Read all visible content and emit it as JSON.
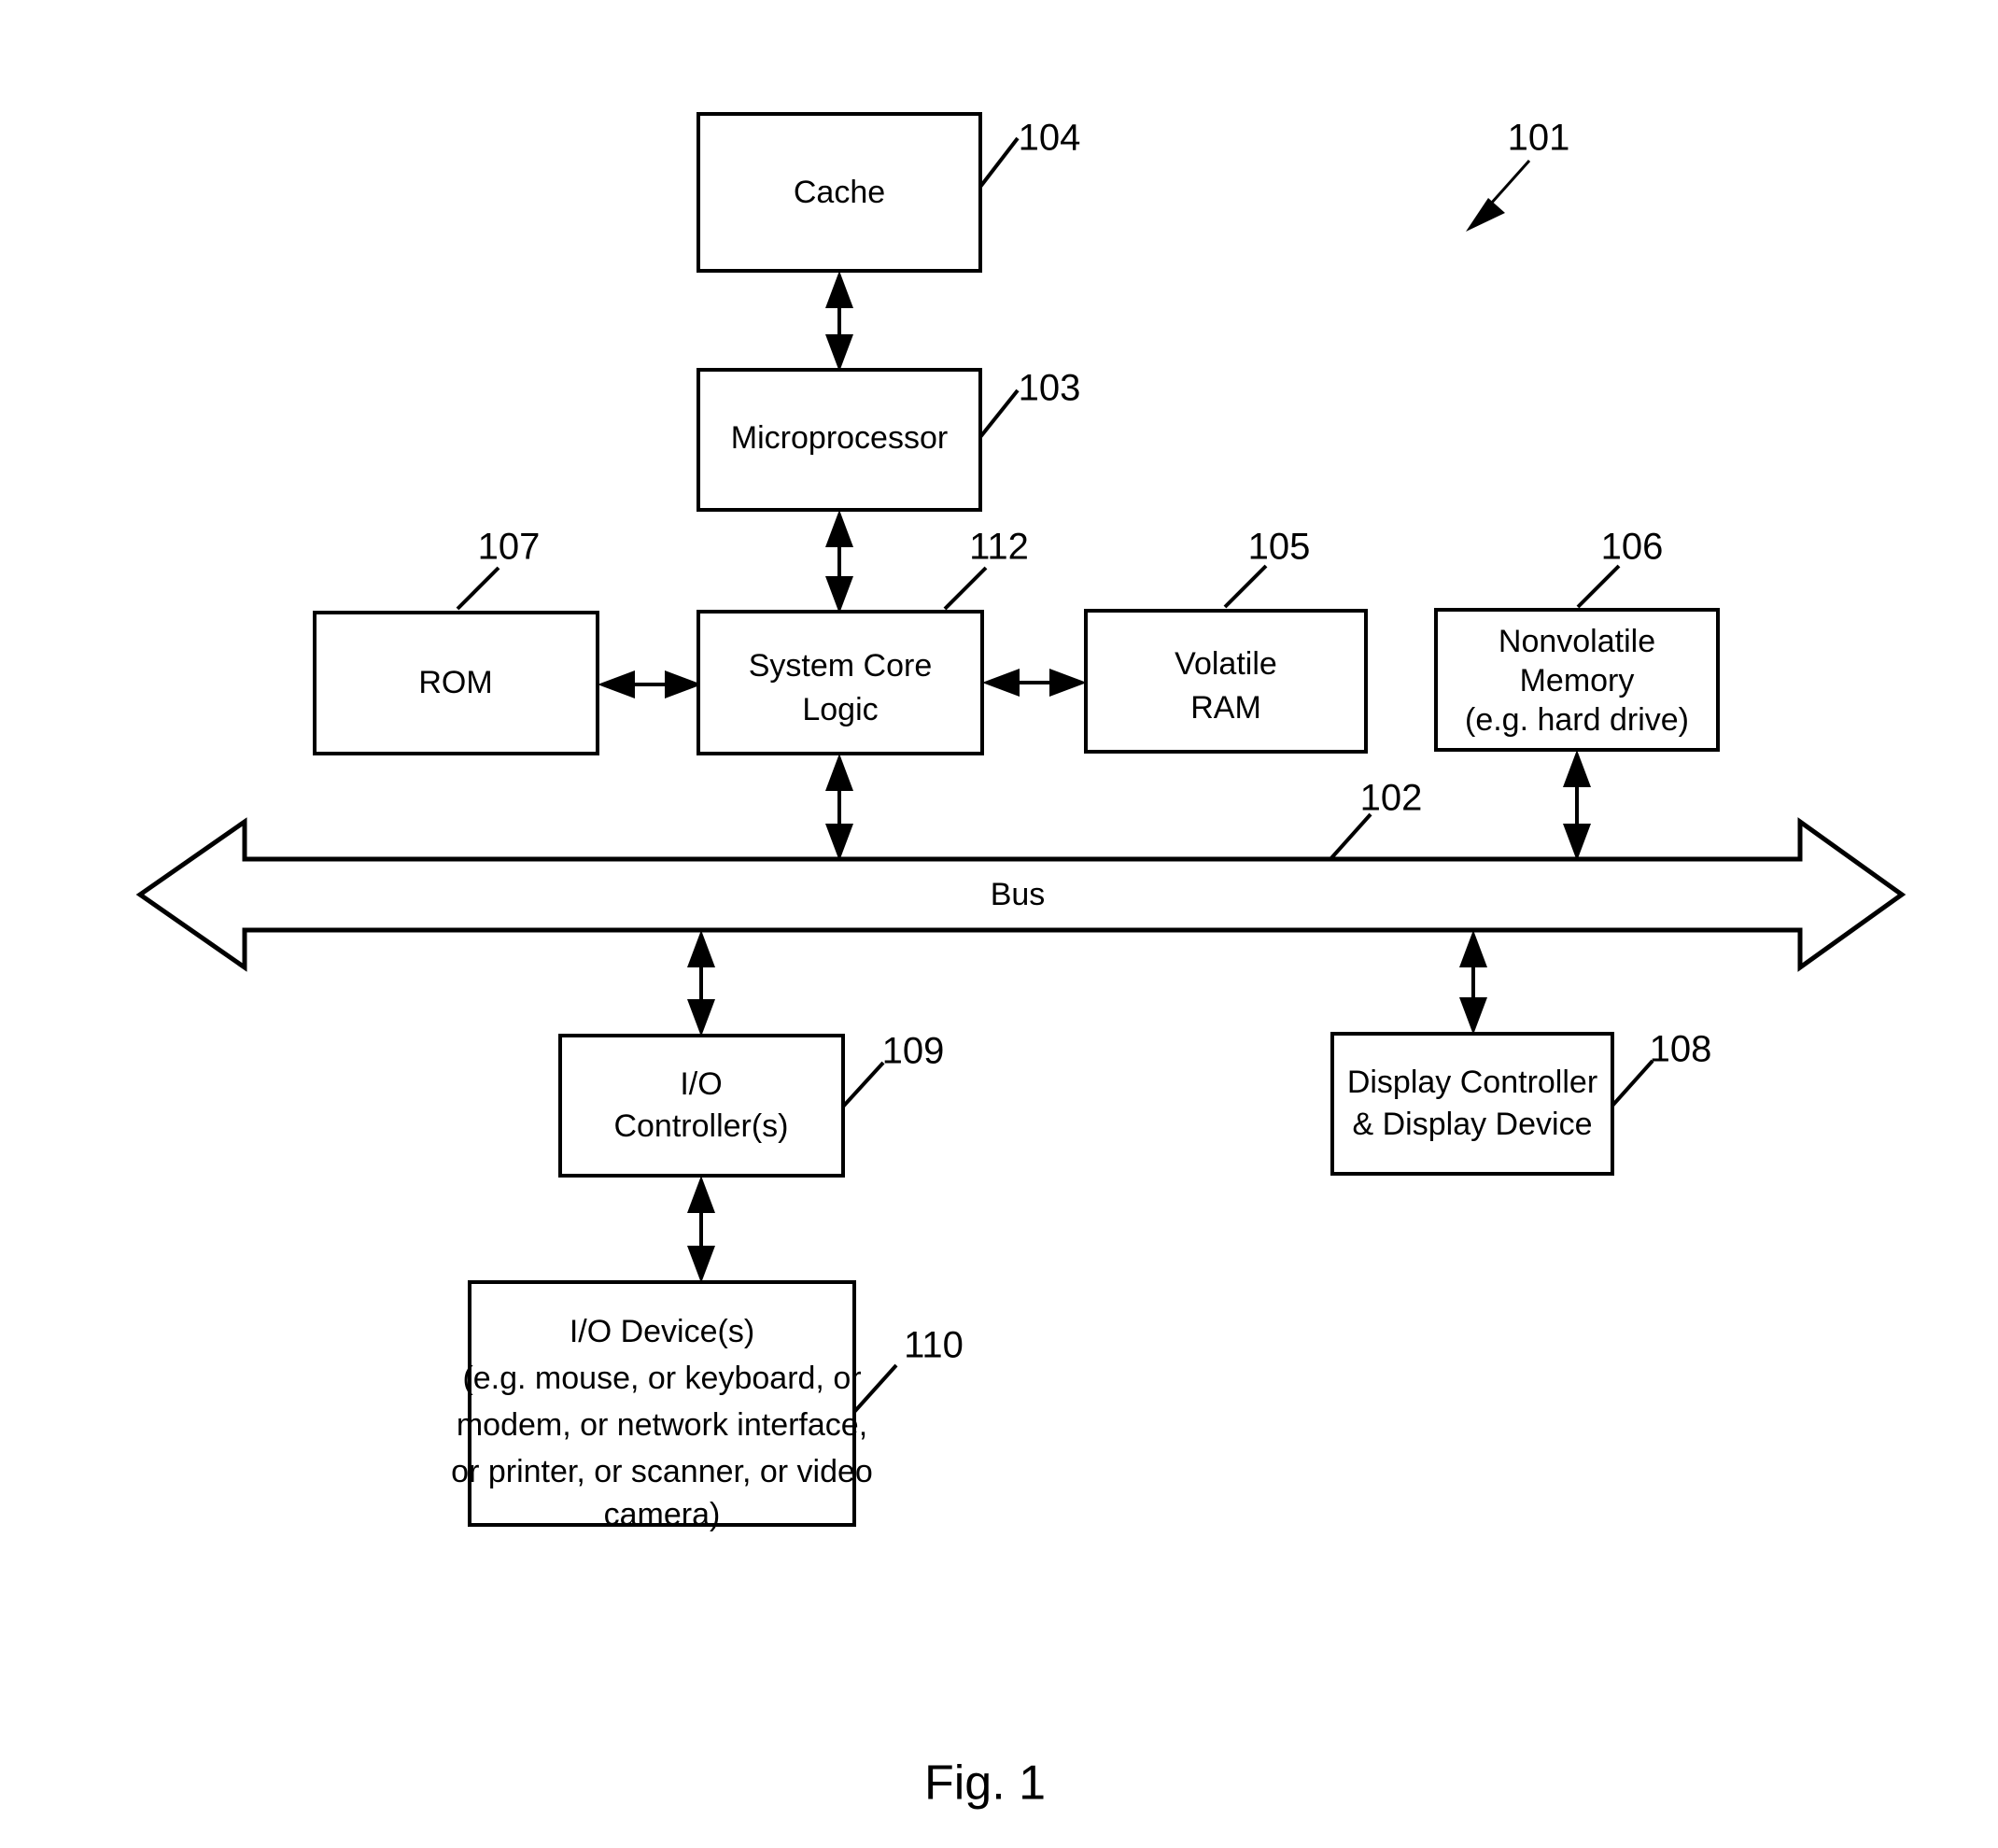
{
  "figure": {
    "caption": "Fig. 1",
    "system_ref": "101"
  },
  "blocks": [
    {
      "id": "cache",
      "ref": "104",
      "lines": [
        "Cache"
      ]
    },
    {
      "id": "microprocessor",
      "ref": "103",
      "lines": [
        "Microprocessor"
      ]
    },
    {
      "id": "rom",
      "ref": "107",
      "lines": [
        "ROM"
      ]
    },
    {
      "id": "system-core-logic",
      "ref": "112",
      "lines": [
        "System Core",
        "Logic"
      ]
    },
    {
      "id": "volatile-ram",
      "ref": "105",
      "lines": [
        "Volatile",
        "RAM"
      ]
    },
    {
      "id": "nonvolatile-memory",
      "ref": "106",
      "lines": [
        "Nonvolatile",
        "Memory",
        "(e.g. hard drive)"
      ]
    },
    {
      "id": "bus",
      "ref": "102",
      "lines": [
        "Bus"
      ]
    },
    {
      "id": "io-controllers",
      "ref": "109",
      "lines": [
        "I/O",
        "Controller(s)"
      ]
    },
    {
      "id": "display-controller",
      "ref": "108",
      "lines": [
        "Display Controller",
        "& Display Device"
      ]
    },
    {
      "id": "io-devices",
      "ref": "110",
      "lines": [
        "I/O Device(s)",
        "(e.g. mouse, or keyboard, or",
        "modem, or network interface,",
        "or printer, or scanner, or video",
        "camera)"
      ]
    }
  ],
  "text": {
    "cache_line1": "Cache",
    "cache_ref": "104",
    "microprocessor_line1": "Microprocessor",
    "microprocessor_ref": "103",
    "rom_line1": "ROM",
    "rom_ref": "107",
    "scl_line1": "System Core",
    "scl_line2": "Logic",
    "scl_ref": "112",
    "vram_line1": "Volatile",
    "vram_line2": "RAM",
    "vram_ref": "105",
    "nvm_line1": "Nonvolatile",
    "nvm_line2": "Memory",
    "nvm_line3": "(e.g. hard drive)",
    "nvm_ref": "106",
    "bus_label": "Bus",
    "bus_ref": "102",
    "ioc_line1": "I/O",
    "ioc_line2": "Controller(s)",
    "ioc_ref": "109",
    "disp_line1": "Display Controller",
    "disp_line2": "& Display Device",
    "disp_ref": "108",
    "iodev_line1": "I/O Device(s)",
    "iodev_line2": "(e.g. mouse, or keyboard, or",
    "iodev_line3": "modem, or network interface,",
    "iodev_line4": "or printer, or scanner, or video",
    "iodev_line5": "camera)",
    "iodev_ref": "110",
    "system_ref": "101",
    "figure_caption": "Fig. 1"
  },
  "colors": {
    "stroke": "#000000",
    "fill": "#ffffff",
    "background": "#ffffff"
  }
}
